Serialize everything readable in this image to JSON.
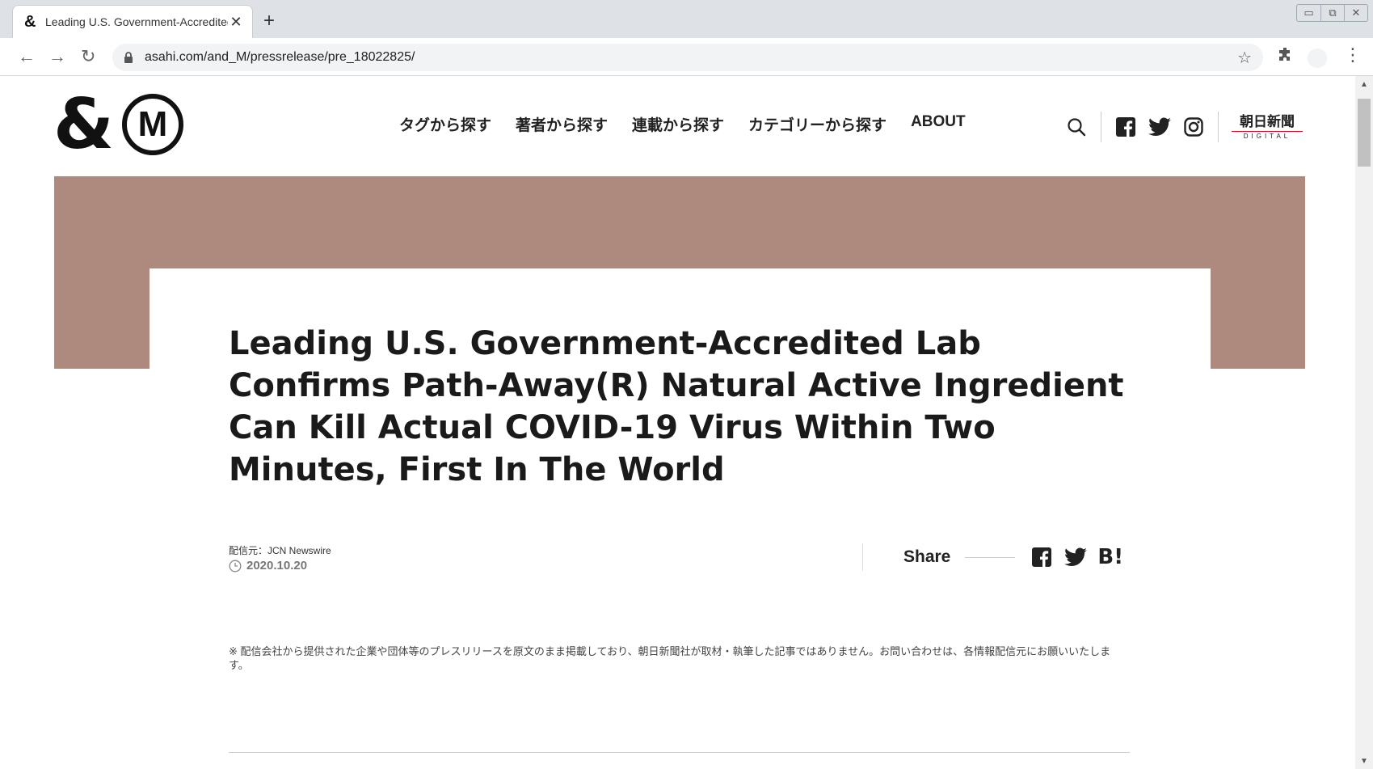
{
  "browser": {
    "tab_favicon": "&",
    "tab_title": "Leading U.S. Government-Accredited Lab Confirms",
    "tab_close": "✕",
    "new_tab": "+",
    "url": "asahi.com/and_M/pressrelease/pre_18022825/",
    "window_controls": [
      "▭",
      "⧉",
      "✕"
    ]
  },
  "site": {
    "logo_amp": "&",
    "logo_m": "M",
    "nav": [
      "タグから探す",
      "著者から探す",
      "連載から探す",
      "カテゴリーから探す",
      "ABOUT"
    ],
    "asahi_logo_jp": "朝日新聞",
    "asahi_logo_en": "DIGITAL"
  },
  "article": {
    "title": "Leading U.S. Government-Accredited Lab Confirms Path-Away(R) Natural Active Ingredient Can Kill Actual COVID-19 Virus Within Two Minutes, First In The World",
    "source": "配信元：JCN Newswire",
    "date": "2020.10.20",
    "share_label": "Share",
    "hatena_label": "B!",
    "disclaimer": "※ 配信会社から提供された企業や団体等のプレスリリースを原文のまま掲載しており、朝日新聞社が取材・執筆した記事ではありません。お問い合わせは、各情報配信元にお願いいたします。"
  },
  "colors": {
    "hero": "#ad8a7d",
    "asahi_red": "#c8102e"
  }
}
